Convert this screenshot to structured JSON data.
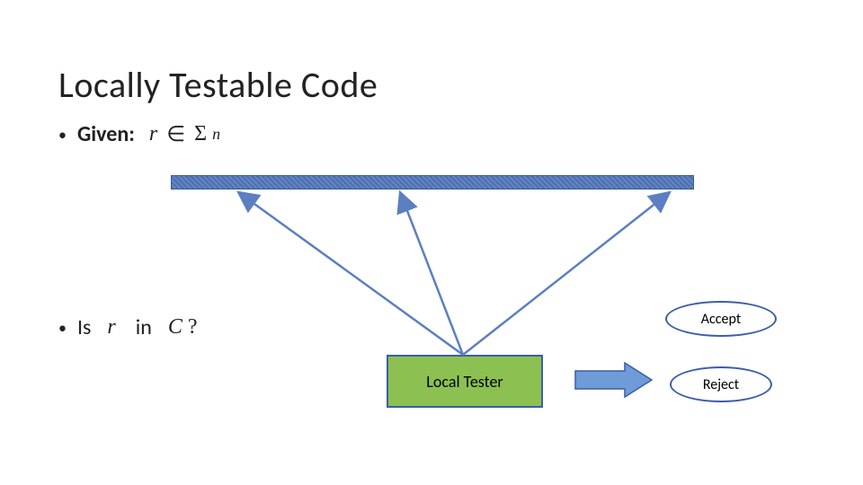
{
  "title": "Locally Testable Code",
  "given": {
    "label": "Given:",
    "expr_r": "r",
    "expr_in": "∈",
    "expr_sigma": "Σ",
    "expr_sup": "n"
  },
  "question": {
    "prefix": "Is",
    "r": "r",
    "mid": "in",
    "C": "C",
    "q": "?"
  },
  "tester": {
    "label": "Local Tester"
  },
  "outcomes": {
    "accept": "Accept",
    "reject": "Reject"
  },
  "colors": {
    "accent": "#3a5ea8",
    "tester_fill": "#8cc152"
  }
}
